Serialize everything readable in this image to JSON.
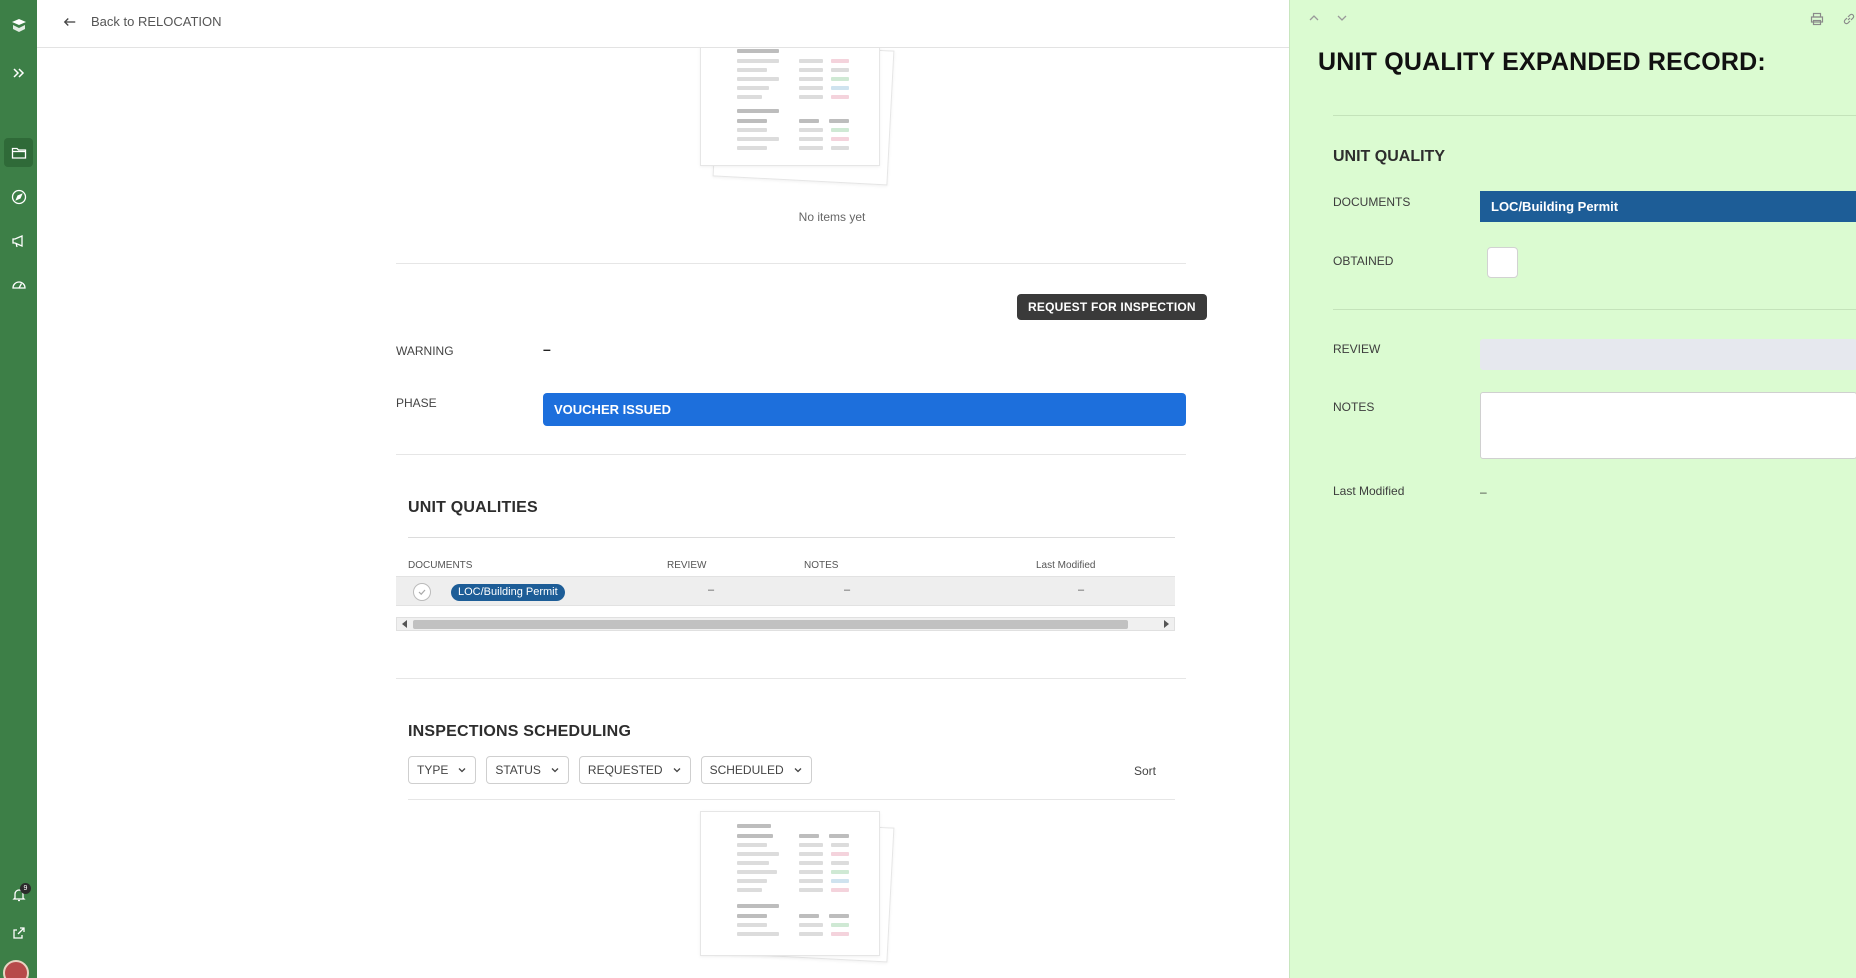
{
  "topbar": {
    "back_label": "Back to RELOCATION"
  },
  "rail": {
    "notification_count": "9"
  },
  "main": {
    "empty_message": "No items yet",
    "request_button": "REQUEST FOR INSPECTION",
    "warning_label": "WARNING",
    "warning_value": "–",
    "phase_label": "PHASE",
    "phase_value": "VOUCHER ISSUED",
    "unit_qualities": {
      "title": "UNIT QUALITIES",
      "columns": [
        "DOCUMENTS",
        "REVIEW",
        "NOTES",
        "Last Modified"
      ],
      "rows": [
        {
          "document": "LOC/Building Permit",
          "review": "–",
          "notes": "–",
          "last_modified": "–"
        }
      ]
    },
    "inspections": {
      "title": "INSPECTIONS SCHEDULING",
      "filters": [
        "TYPE",
        "STATUS",
        "REQUESTED",
        "SCHEDULED"
      ],
      "sort_label": "Sort"
    }
  },
  "panel": {
    "title": "UNIT QUALITY EXPANDED RECORD:",
    "section_title": "UNIT QUALITY",
    "documents_label": "DOCUMENTS",
    "documents_value": "LOC/Building Permit",
    "obtained_label": "OBTAINED",
    "review_label": "REVIEW",
    "notes_label": "NOTES",
    "last_modified_label": "Last Modified",
    "last_modified_value": "–"
  },
  "colors": {
    "rail": "#3d7f47",
    "phase": "#1d6fdc",
    "pill": "#1d5d97",
    "panel_bg": "#dbfbd1"
  }
}
